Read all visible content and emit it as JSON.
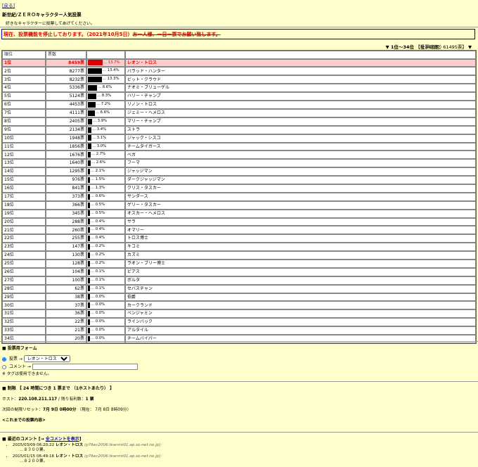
{
  "nav": {
    "top_link": "[戻る]"
  },
  "page": {
    "title": "新世紀/ＺＥＲＯキャラクター人気投票",
    "subtitle": "好きなキャラクターに投票してあげてください。"
  },
  "notice": {
    "main": "現在、投票機能を停止しております。（2021年10月5日）",
    "struck": "お一人様、一日一票でお願い致します。"
  },
  "pager": {
    "range": "▼ 1位～34位",
    "count": "（全34項目）",
    "total": "【投票総数：61495票】 ▼"
  },
  "table": {
    "headers": {
      "rank": "順位",
      "votes": "票数"
    },
    "rows": [
      {
        "rank": "1位",
        "votes": "8459票",
        "pct": "13.7%",
        "name": "レオン・トロス",
        "ratio": 0.137
      },
      {
        "rank": "2位",
        "votes": "8277票",
        "pct": "13.4%",
        "name": "バラッド・ハンター",
        "ratio": 0.134
      },
      {
        "rank": "3位",
        "votes": "8232票",
        "pct": "13.3%",
        "name": "ビット・クラウド",
        "ratio": 0.133
      },
      {
        "rank": "4位",
        "votes": "5336票",
        "pct": "8.6%",
        "name": "ナオミ・ブリューゲル",
        "ratio": 0.086
      },
      {
        "rank": "5位",
        "votes": "5124票",
        "pct": "8.3%",
        "name": "ハリー・チャンプ",
        "ratio": 0.083
      },
      {
        "rank": "6位",
        "votes": "4453票",
        "pct": "7.2%",
        "name": "リノン・トロス",
        "ratio": 0.072
      },
      {
        "rank": "7位",
        "votes": "4111票",
        "pct": "6.6%",
        "name": "ジェミー・ヘメロス",
        "ratio": 0.066
      },
      {
        "rank": "8位",
        "votes": "2405票",
        "pct": "3.9%",
        "name": "マリー・チャンプ",
        "ratio": 0.039
      },
      {
        "rank": "9位",
        "votes": "2134票",
        "pct": "3.4%",
        "name": "ストラ",
        "ratio": 0.034
      },
      {
        "rank": "10位",
        "votes": "1948票",
        "pct": "3.1%",
        "name": "ジャック・シスコ",
        "ratio": 0.031
      },
      {
        "rank": "11位",
        "votes": "1856票",
        "pct": "3.0%",
        "name": "チームタイガース",
        "ratio": 0.03
      },
      {
        "rank": "12位",
        "votes": "1676票",
        "pct": "2.7%",
        "name": "ベガ",
        "ratio": 0.027
      },
      {
        "rank": "13位",
        "votes": "1640票",
        "pct": "2.6%",
        "name": "フーマ",
        "ratio": 0.026
      },
      {
        "rank": "14位",
        "votes": "1295票",
        "pct": "2.1%",
        "name": "ジャッジマン",
        "ratio": 0.021
      },
      {
        "rank": "15位",
        "votes": "976票",
        "pct": "1.5%",
        "name": "ダークジャッジマン",
        "ratio": 0.015
      },
      {
        "rank": "16位",
        "votes": "841票",
        "pct": "1.3%",
        "name": "クリス・タスカー",
        "ratio": 0.013
      },
      {
        "rank": "17位",
        "votes": "373票",
        "pct": "0.6%",
        "name": "サンダース",
        "ratio": 0.006
      },
      {
        "rank": "18位",
        "votes": "366票",
        "pct": "0.5%",
        "name": "ゲリー・タスカー",
        "ratio": 0.005
      },
      {
        "rank": "19位",
        "votes": "345票",
        "pct": "0.5%",
        "name": "オスカー・ヘメロス",
        "ratio": 0.005
      },
      {
        "rank": "20位",
        "votes": "288票",
        "pct": "0.4%",
        "name": "サラ",
        "ratio": 0.004
      },
      {
        "rank": "21位",
        "votes": "260票",
        "pct": "0.4%",
        "name": "オマリー",
        "ratio": 0.004
      },
      {
        "rank": "22位",
        "votes": "255票",
        "pct": "0.4%",
        "name": "トロス博士",
        "ratio": 0.004
      },
      {
        "rank": "23位",
        "votes": "147票",
        "pct": "0.2%",
        "name": "キコミ",
        "ratio": 0.002
      },
      {
        "rank": "24位",
        "votes": "130票",
        "pct": "0.2%",
        "name": "カズミ",
        "ratio": 0.002
      },
      {
        "rank": "25位",
        "votes": "128票",
        "pct": "0.2%",
        "name": "ラオン・ブリー博士",
        "ratio": 0.002
      },
      {
        "rank": "26位",
        "votes": "104票",
        "pct": "0.1%",
        "name": "ピアス",
        "ratio": 0.001
      },
      {
        "rank": "27位",
        "votes": "100票",
        "pct": "0.1%",
        "name": "ボルタ",
        "ratio": 0.001
      },
      {
        "rank": "28位",
        "votes": "62票",
        "pct": "0.1%",
        "name": "セバスチャン",
        "ratio": 0.001
      },
      {
        "rank": "29位",
        "votes": "38票",
        "pct": "0.0%",
        "name": "伯爵",
        "ratio": 0.0
      },
      {
        "rank": "30位",
        "votes": "37票",
        "pct": "0.0%",
        "name": "カークランド",
        "ratio": 0.0
      },
      {
        "rank": "31位",
        "votes": "36票",
        "pct": "0.0%",
        "name": "ベンジャミン",
        "ratio": 0.0
      },
      {
        "rank": "32位",
        "votes": "22票",
        "pct": "0.0%",
        "name": "ラインバック",
        "ratio": 0.0
      },
      {
        "rank": "33位",
        "votes": "21票",
        "pct": "0.0%",
        "name": "アルタイル",
        "ratio": 0.0
      },
      {
        "rank": "34位",
        "votes": "20票",
        "pct": "0.0%",
        "name": "チームバイパー",
        "ratio": 0.0
      }
    ]
  },
  "form": {
    "title": "■ 投票用フォーム",
    "vote_label": "投票 →",
    "selected": "レオン・トロス",
    "comment_label": "コメント →",
    "comment_value": "",
    "note": "※ タグは使用できません。"
  },
  "limit": {
    "title": "■ 制限 【 24 時間につき 1 票まで （1ホストあたり） 】",
    "host_prefix": "ホスト：",
    "host": "220.108.211.117",
    "remaining_prefix": " / 残り有利数：",
    "remaining": "1 票",
    "reset_prefix": "次回の制限リセット：",
    "reset": "7月 9日 0時00分",
    "now": "（現在： 7月 8日 8時09分）",
    "history_link": "<これまでの投票内容>"
  },
  "recent": {
    "title_prefix": "■ 最近のコメント [→ ",
    "title_link": "全コメントを表示",
    "title_suffix": "]",
    "comments": [
      {
        "date": "2015/03/09 06:20:22",
        "name": "レオン・トロス",
        "host": "(p76ec2006.tkanmt01.ap.so-net.ne.jp)",
        "body": "…８３００票。"
      },
      {
        "date": "2015/01/15 06:49:16",
        "name": "レオン・トロス",
        "host": "(p76ec2006.tkanmt01.ap.so-net.ne.jp)",
        "body": "…８２００票。"
      }
    ]
  }
}
